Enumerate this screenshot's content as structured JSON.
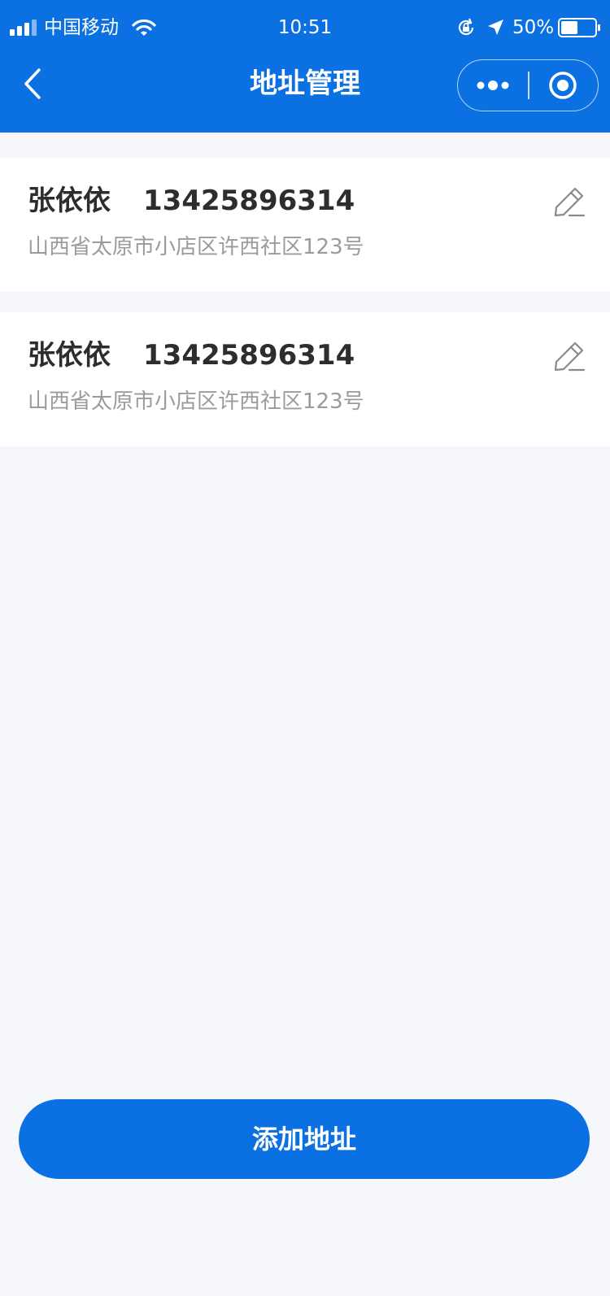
{
  "status_bar": {
    "carrier": "中国移动",
    "time": "10:51",
    "battery_percent": "50%",
    "battery_level": 0.5,
    "icons": [
      "signal-icon",
      "wifi-icon",
      "rotation-lock-icon",
      "location-arrow-icon",
      "battery-icon"
    ]
  },
  "nav": {
    "title": "地址管理",
    "back_icon": "chevron-left-icon",
    "more_icon": "more-dots-icon",
    "close_icon": "target-close-icon"
  },
  "addresses": [
    {
      "name": "张依依",
      "phone": "13425896314",
      "address": "山西省太原市小店区许西社区123号",
      "edit_icon": "pencil-icon"
    },
    {
      "name": "张依依",
      "phone": "13425896314",
      "address": "山西省太原市小店区许西社区123号",
      "edit_icon": "pencil-icon"
    }
  ],
  "add_button_label": "添加地址",
  "colors": {
    "primary": "#0b70e1",
    "background": "#f5f7fb",
    "card": "#ffffff",
    "text_primary": "#2d2d2d",
    "text_secondary": "#9b9b9b"
  }
}
